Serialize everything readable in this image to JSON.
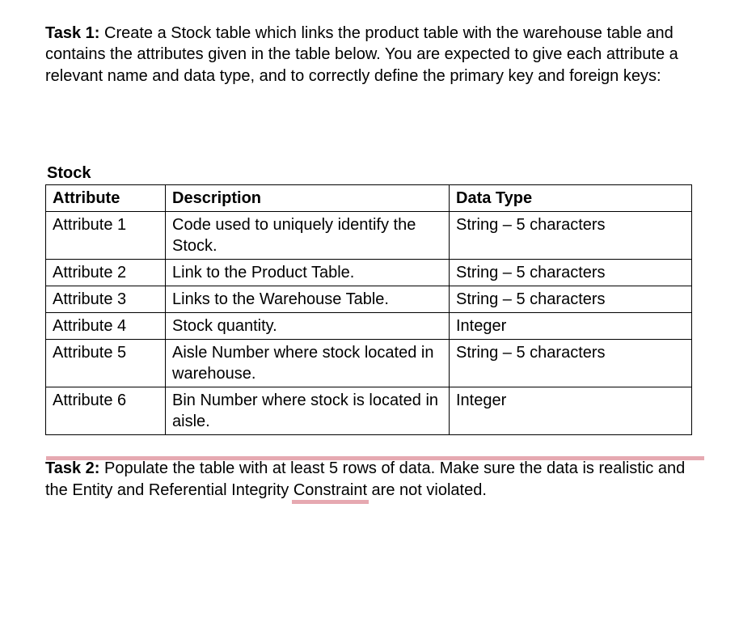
{
  "task1": {
    "label": "Task 1:",
    "text": "Create a Stock table which links the product table with the warehouse table and contains the attributes given in the table below.  You are expected to give each attribute a relevant name and data type, and to correctly define the primary key and foreign keys:"
  },
  "table": {
    "title": "Stock",
    "headers": {
      "attribute": "Attribute",
      "description": "Description",
      "datatype": "Data Type"
    },
    "rows": [
      {
        "attr": "Attribute 1",
        "desc": "Code used to uniquely identify the Stock.",
        "type": "String – 5 characters",
        "justify": false
      },
      {
        "attr": "Attribute 2",
        "desc": "Link to the Product Table.",
        "type": "String – 5 characters",
        "justify": false
      },
      {
        "attr": "Attribute 3",
        "desc": "Links to the Warehouse Table.",
        "type": "String – 5 characters",
        "justify": true
      },
      {
        "attr": "Attribute 4",
        "desc": "Stock quantity.",
        "type": "Integer",
        "justify": false
      },
      {
        "attr": "Attribute 5",
        "desc": "Aisle Number where stock located in warehouse.",
        "type": "String – 5 characters",
        "justify": true
      },
      {
        "attr": "Attribute 6",
        "desc": "Bin Number where stock is located in aisle.",
        "type": "Integer",
        "justify": true
      }
    ]
  },
  "task2": {
    "label": "Task 2:",
    "text_before": "Populate the table with at least 5 rows of data.  Make sure the data is realistic and the Entity and Referential Integrity ",
    "underlined": "Constraint",
    "text_after": " are not violated."
  },
  "accent_color": "#e6a9b1"
}
